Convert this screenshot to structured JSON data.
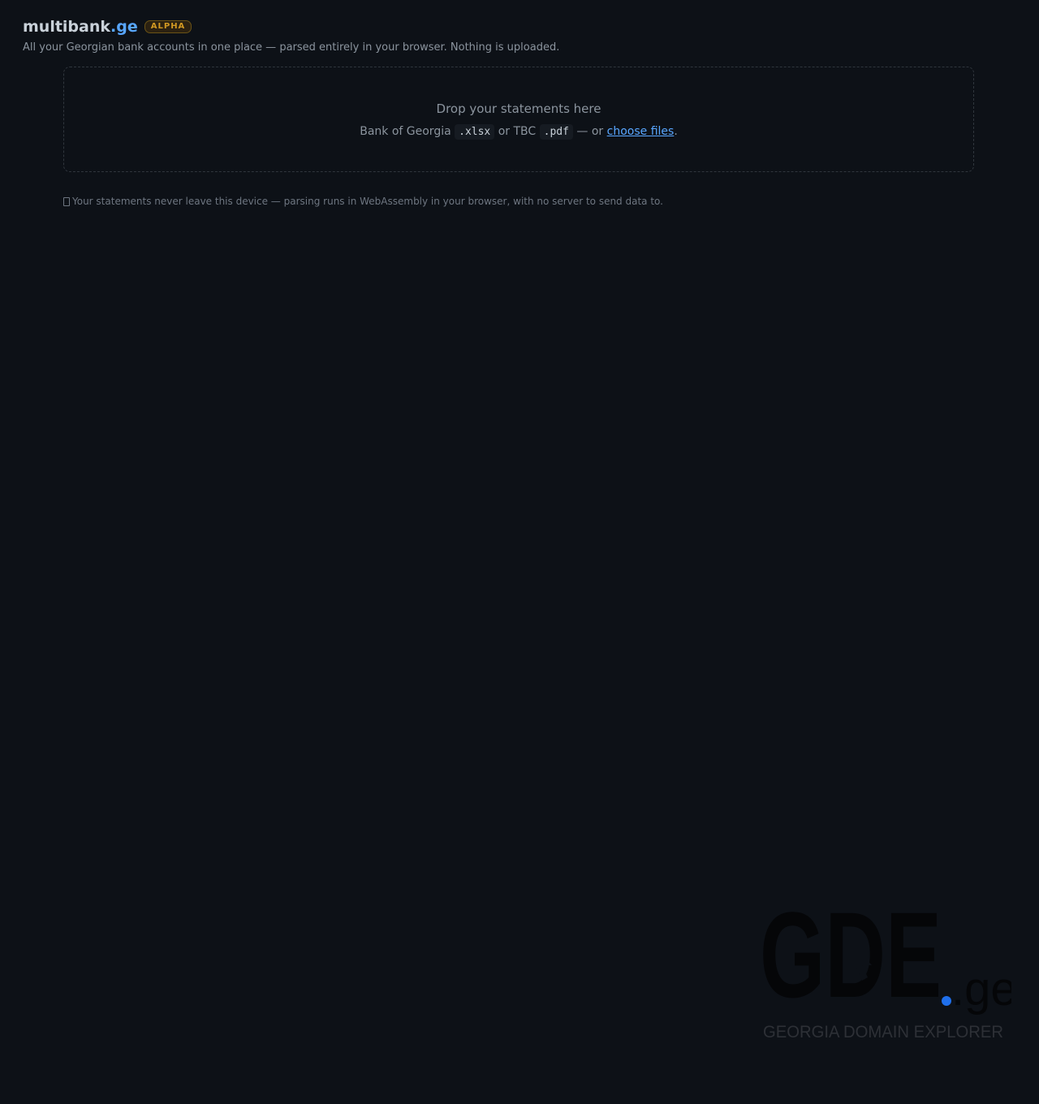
{
  "header": {
    "brand_name": "multibank",
    "brand_tld": ".ge",
    "badge": "ALPHA",
    "tagline": "All your Georgian bank accounts in one place — parsed entirely in your browser. Nothing is uploaded."
  },
  "dropzone": {
    "title": "Drop your statements here",
    "prefix": "Bank of Georgia",
    "format_boG": ".xlsx",
    "mid": "or TBC",
    "format_tbc": ".pdf",
    "or_text": "— or",
    "choose_files": "choose files",
    "suffix": "."
  },
  "privacy": {
    "text": "Your statements never leave this device — parsing runs in WebAssembly in your browser, with no server to send data to."
  },
  "watermark": {
    "logo_text": "GDE",
    "tld": ".ge",
    "tagline": "GEORGIA DOMAIN EXPLORER",
    "colors": {
      "letters": "#050608",
      "dot": "#1f6feb",
      "tagline": "#2d3036"
    }
  }
}
